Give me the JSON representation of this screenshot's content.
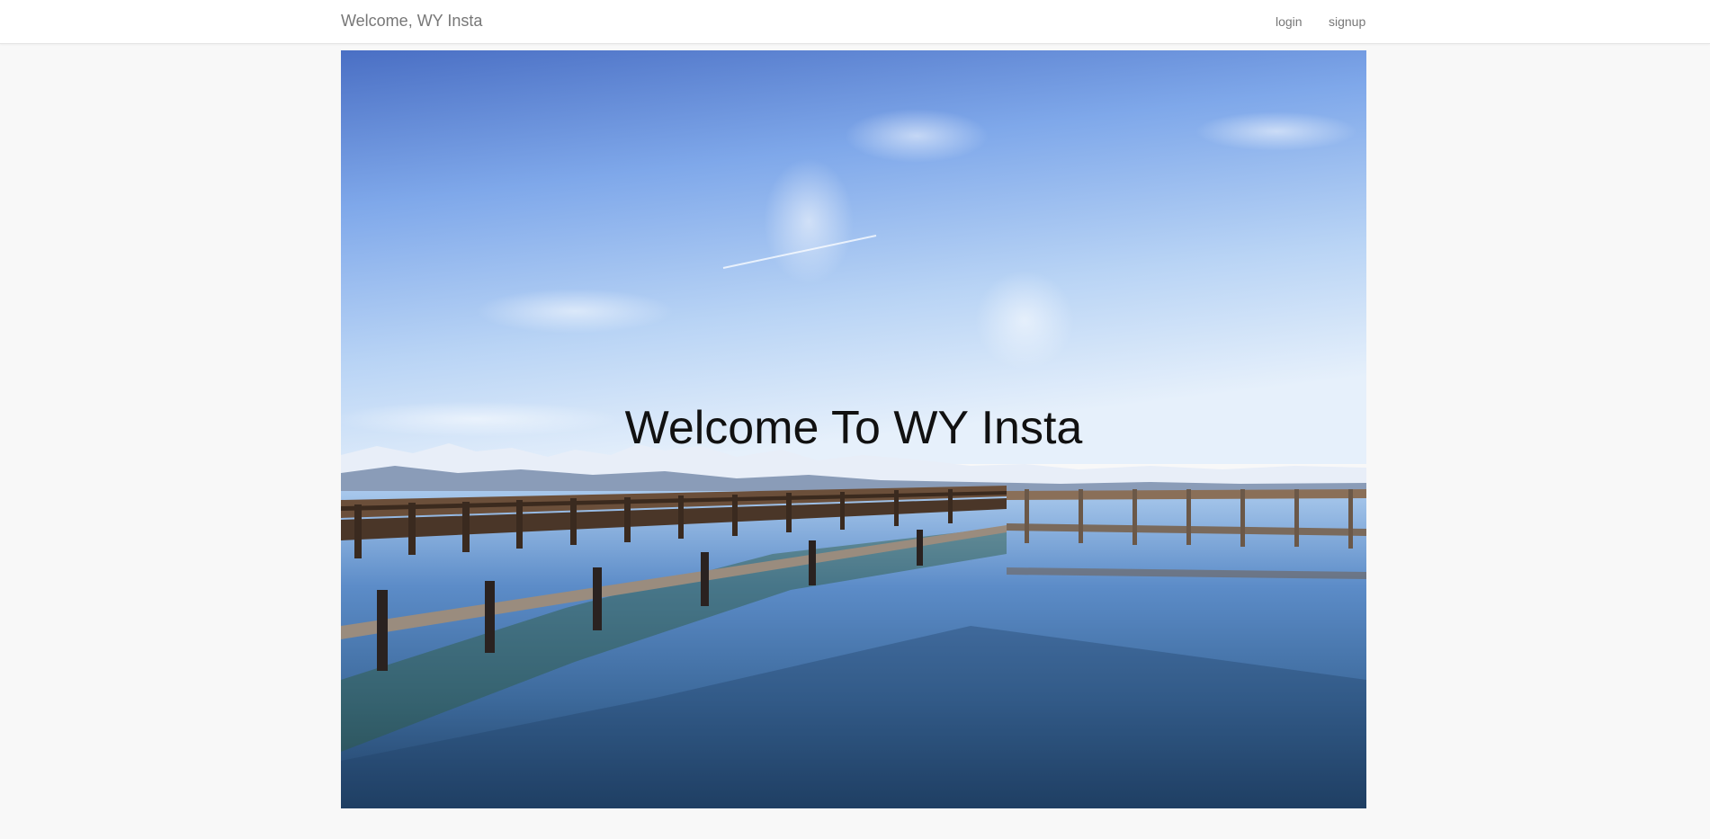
{
  "navbar": {
    "brand": "Welcome, WY Insta",
    "links": [
      {
        "label": "login"
      },
      {
        "label": "signup"
      }
    ]
  },
  "hero": {
    "title": "Welcome To WY Insta",
    "image_subject": "wooden pier over lake with snowy mountains and blue sky"
  },
  "colors": {
    "page_bg": "#f8f8f8",
    "navbar_bg": "#ffffff",
    "nav_text": "#777777",
    "hero_text": "#111111"
  }
}
